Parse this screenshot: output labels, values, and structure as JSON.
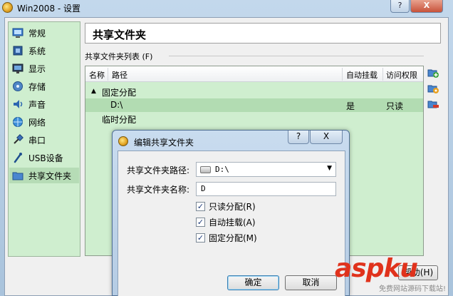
{
  "window": {
    "title": "Win2008 - 设置",
    "help_button": "?",
    "close_button": "X"
  },
  "sidebar": {
    "items": [
      {
        "label": "常规",
        "icon": "general-icon"
      },
      {
        "label": "系统",
        "icon": "system-icon"
      },
      {
        "label": "显示",
        "icon": "display-icon"
      },
      {
        "label": "存储",
        "icon": "storage-icon"
      },
      {
        "label": "声音",
        "icon": "audio-icon"
      },
      {
        "label": "网络",
        "icon": "network-icon"
      },
      {
        "label": "串口",
        "icon": "serial-port-icon"
      },
      {
        "label": "USB设备",
        "icon": "usb-icon"
      },
      {
        "label": "共享文件夹",
        "icon": "shared-folder-icon",
        "selected": true
      }
    ]
  },
  "main": {
    "header_title": "共享文件夹",
    "list_group_label": "共享文件夹列表 (F)",
    "columns": [
      "名称",
      "路径",
      "自动挂载",
      "访问权限"
    ],
    "tree": {
      "groups": [
        {
          "label": "固定分配",
          "expander": "▲",
          "rows": [
            {
              "name": "D:\\",
              "auto_mount": "是",
              "access": "只读"
            }
          ]
        },
        {
          "label": "临时分配"
        }
      ]
    },
    "side_buttons": [
      "add-folder-icon",
      "edit-folder-icon",
      "remove-folder-icon"
    ],
    "help_button_label": "帮助(H)"
  },
  "dialog": {
    "title": "编辑共享文件夹",
    "help_button": "?",
    "close_button": "X",
    "path_label": "共享文件夹路径:",
    "path_value": "D:\\",
    "name_label": "共享文件夹名称:",
    "name_value": "D",
    "checkboxes": [
      {
        "label": "只读分配(R)",
        "checked": true
      },
      {
        "label": "自动挂载(A)",
        "checked": true
      },
      {
        "label": "固定分配(M)",
        "checked": true
      }
    ],
    "ok_label": "确定",
    "cancel_label": "取消"
  },
  "watermark": {
    "brand": "aspku",
    "tagline": "免费网站源码下载站!"
  },
  "colors": {
    "sidebar_bg": "#cfeecf",
    "selected_bg": "#b6dcb6",
    "titlebar": "#b9cfe4",
    "watermark_red": "#e0321c"
  }
}
